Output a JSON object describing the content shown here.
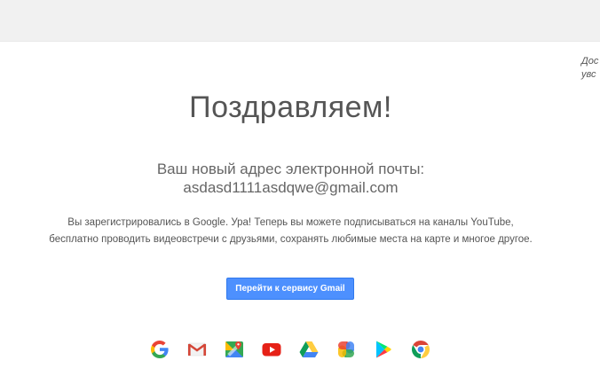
{
  "side_note": {
    "line1": "Дос",
    "line2": "увс"
  },
  "main": {
    "title": "Поздравляем!",
    "subtitle_line1": "Ваш новый адрес электронной почты:",
    "email": "asdasd1111asdqwe@gmail.com",
    "description_line1": "Вы зарегистрировались в Google. Ура! Теперь вы можете подписываться на каналы YouTube,",
    "description_line2": "бесплатно проводить видеовстречи с друзьями, сохранять любимые места на карте и многое другое.",
    "button_label": "Перейти к сервису Gmail"
  },
  "apps": [
    {
      "icon": "google-icon"
    },
    {
      "icon": "gmail-icon"
    },
    {
      "icon": "maps-icon"
    },
    {
      "icon": "youtube-icon"
    },
    {
      "icon": "drive-icon"
    },
    {
      "icon": "photos-icon"
    },
    {
      "icon": "play-store-icon"
    },
    {
      "icon": "chrome-icon"
    }
  ],
  "colors": {
    "button": "#4d90fe",
    "top_bar": "#f1f1f1",
    "text": "#555555"
  }
}
